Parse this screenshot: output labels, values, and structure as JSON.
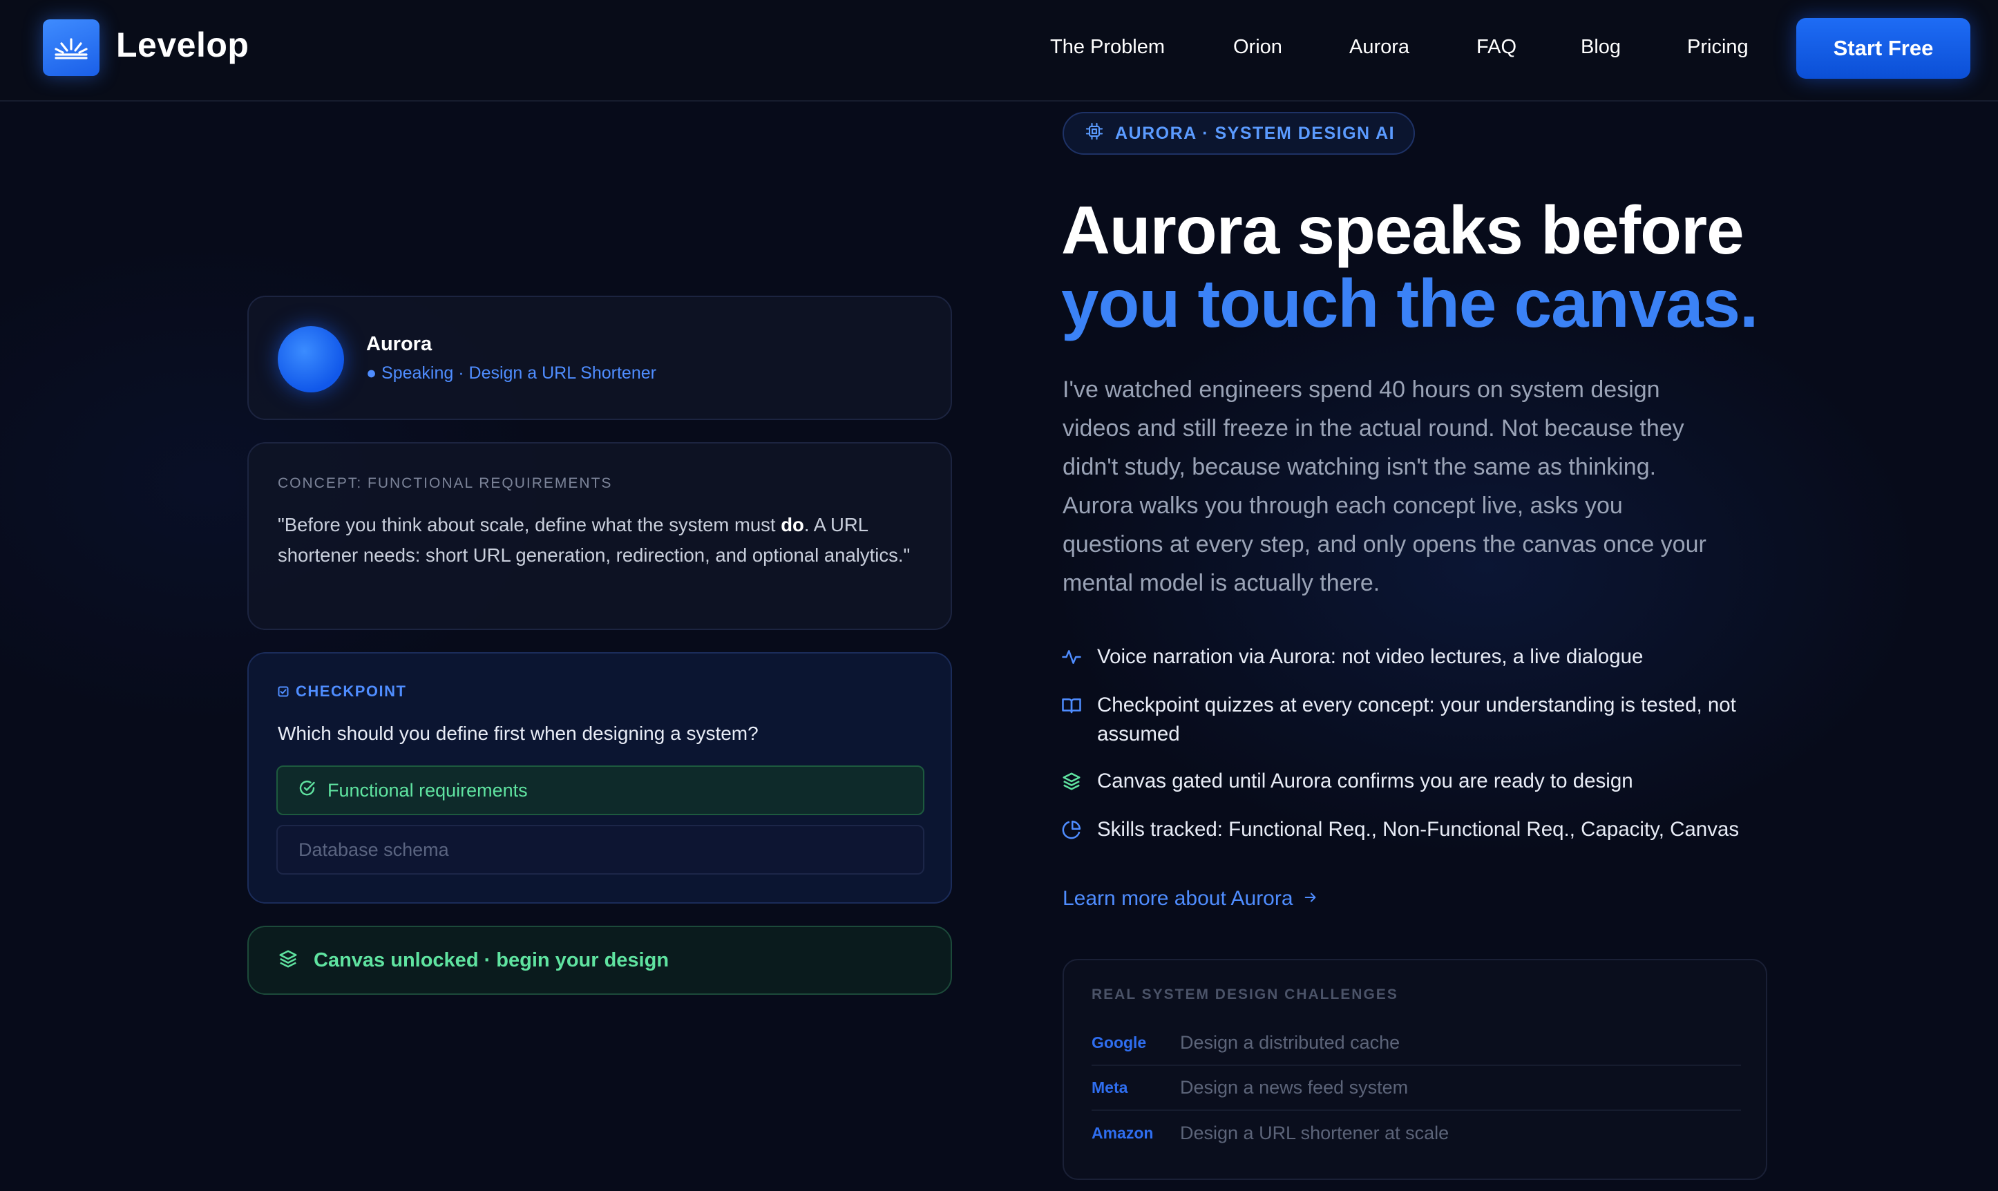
{
  "brand": {
    "name": "Levelop"
  },
  "nav": {
    "links": [
      "The Problem",
      "Orion",
      "Aurora",
      "FAQ",
      "Blog",
      "Pricing"
    ],
    "cta": "Start Free"
  },
  "aurora_card": {
    "name": "Aurora",
    "status": "● Speaking · Design a URL Shortener"
  },
  "concept_card": {
    "label": "CONCEPT: FUNCTIONAL REQUIREMENTS",
    "quote_before": "\"Before you think about scale, define what the system must ",
    "quote_bold": "do",
    "quote_after": ". A URL shortener needs: short URL generation, redirection, and optional analytics.\""
  },
  "checkpoint": {
    "label": "CHECKPOINT",
    "question": "Which should you define first when designing a system?",
    "options": [
      {
        "label": "Functional requirements",
        "state": "correct"
      },
      {
        "label": "Database schema",
        "state": "unselected"
      }
    ]
  },
  "unlocked": {
    "text": "Canvas unlocked · begin your design"
  },
  "hero": {
    "pill": "AURORA · SYSTEM DESIGN AI",
    "title_line1": "Aurora speaks before",
    "title_line2": "you touch the canvas.",
    "lead": "I've watched engineers spend 40 hours on system design videos and still freeze in the actual round. Not because they didn't study, because watching isn't the same as thinking. Aurora walks you through each concept live, asks you questions at every step, and only opens the canvas once your mental model is actually there."
  },
  "features": [
    {
      "icon": "activity-icon",
      "text": "Voice narration via Aurora: not video lectures, a live dialogue"
    },
    {
      "icon": "book-open-icon",
      "text": "Checkpoint quizzes at every concept: your understanding is tested, not assumed"
    },
    {
      "icon": "layers-icon",
      "text": "Canvas gated until Aurora confirms you are ready to design"
    },
    {
      "icon": "pie-chart-icon",
      "text": "Skills tracked: Functional Req., Non-Functional Req., Capacity, Canvas"
    }
  ],
  "learn_more": "Learn more about Aurora",
  "challenges": {
    "title": "REAL SYSTEM DESIGN CHALLENGES",
    "rows": [
      {
        "company": "Google",
        "task": "Design a distributed cache"
      },
      {
        "company": "Meta",
        "task": "Design a news feed system"
      },
      {
        "company": "Amazon",
        "task": "Design a URL shortener at scale"
      }
    ]
  },
  "colors": {
    "accent": "#3b82f6",
    "success": "#5fe3a0",
    "background": "#070b1a"
  }
}
